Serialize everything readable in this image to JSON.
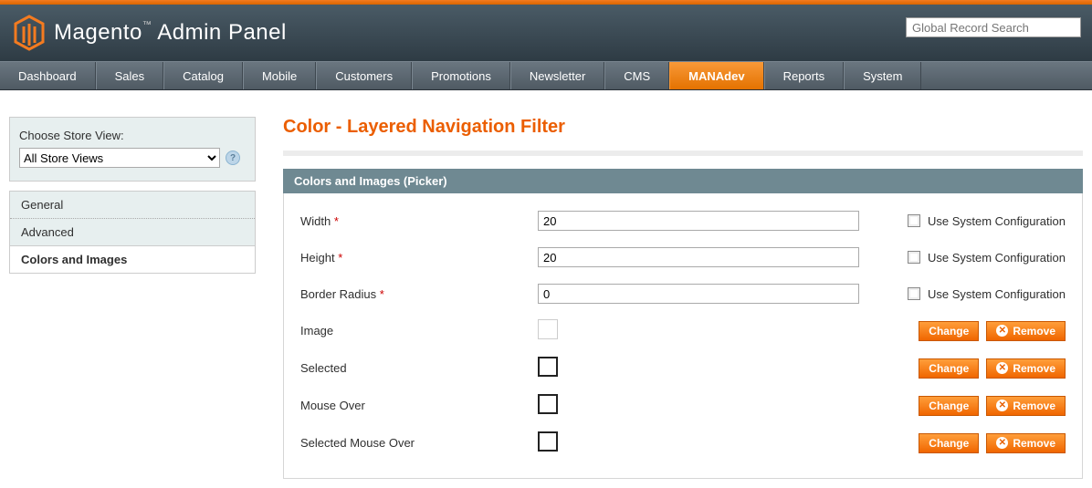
{
  "header": {
    "brand": "Magento",
    "panel": "Admin Panel",
    "search_placeholder": "Global Record Search"
  },
  "nav": {
    "items": [
      "Dashboard",
      "Sales",
      "Catalog",
      "Mobile",
      "Customers",
      "Promotions",
      "Newsletter",
      "CMS",
      "MANAdev",
      "Reports",
      "System"
    ],
    "active_index": 8
  },
  "sidebar": {
    "store_label": "Choose Store View:",
    "store_value": "All Store Views",
    "tabs": [
      "General",
      "Advanced",
      "Colors and Images"
    ],
    "active_tab_index": 2
  },
  "page": {
    "title": "Color - Layered Navigation Filter",
    "section_title": "Colors and Images (Picker)"
  },
  "labels": {
    "use_system": "Use System Configuration",
    "change": "Change",
    "remove": "Remove"
  },
  "fields": {
    "width": {
      "label": "Width",
      "required": true,
      "value": "20",
      "control": "sys"
    },
    "height": {
      "label": "Height",
      "required": true,
      "value": "20",
      "control": "sys"
    },
    "radius": {
      "label": "Border Radius",
      "required": true,
      "value": "0",
      "control": "sys"
    },
    "image": {
      "label": "Image",
      "control": "btns",
      "bold": false
    },
    "selected": {
      "label": "Selected",
      "control": "btns",
      "bold": true
    },
    "mouse_over": {
      "label": "Mouse Over",
      "control": "btns",
      "bold": true
    },
    "sel_mouse_over": {
      "label": "Selected Mouse Over",
      "control": "btns",
      "bold": true
    }
  }
}
